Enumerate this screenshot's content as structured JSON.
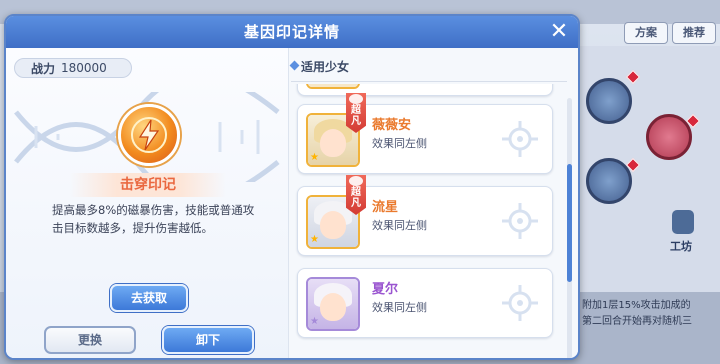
{
  "background": {
    "tabs": [
      "方案",
      "推荐"
    ],
    "robot_label": "工坊",
    "text_lines": [
      "附加1层15%攻击加成的",
      "第二回合开始再对随机三"
    ]
  },
  "dialog": {
    "title": "基因印记详情",
    "close_symbol": "✕"
  },
  "left": {
    "power_label": "战力",
    "power_value": "180000",
    "mark_name": "击穿印记",
    "description": "提高最多8%的磁暴伤害，技能或普通攻击目标数越多，提升伤害越低。",
    "get_button": "去获取",
    "change_button": "更换",
    "unload_button": "卸下"
  },
  "right": {
    "section_title": "适用少女",
    "badge_text": "超凡",
    "characters": [
      {
        "name": "薇薇安",
        "effect": "效果同左侧",
        "name_color": "#ea7a2e",
        "has_badge": true
      },
      {
        "name": "流星",
        "effect": "效果同左侧",
        "name_color": "#ea7a2e",
        "has_badge": true
      },
      {
        "name": "夏尔",
        "effect": "效果同左侧",
        "name_color": "#9a55d0",
        "has_badge": false
      }
    ]
  },
  "colors": {
    "accent": "#4d82d6",
    "orange": "#ea6840"
  }
}
